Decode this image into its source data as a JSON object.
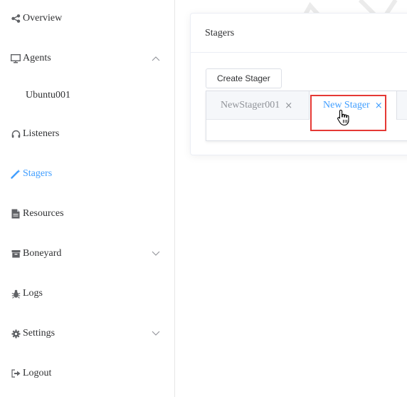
{
  "sidebar": {
    "items": [
      {
        "label": "Overview",
        "icon": "share-icon"
      },
      {
        "label": "Agents",
        "icon": "monitor-icon",
        "expanded": true
      },
      {
        "label": "Ubuntu001"
      },
      {
        "label": "Listeners",
        "icon": "headset-icon"
      },
      {
        "label": "Stagers",
        "icon": "magic-wand-icon",
        "active": true
      },
      {
        "label": "Resources",
        "icon": "document-icon"
      },
      {
        "label": "Boneyard",
        "icon": "box-icon",
        "expanded": false
      },
      {
        "label": "Logs",
        "icon": "bug-icon"
      },
      {
        "label": "Settings",
        "icon": "gear-icon",
        "expanded": false
      },
      {
        "label": "Logout",
        "icon": "logout-icon"
      }
    ]
  },
  "card": {
    "title": "Stagers",
    "create_button": "Create Stager",
    "tabs": [
      {
        "label": "NewStager001",
        "close": "×"
      },
      {
        "label": "New Stager",
        "close": "×",
        "active": true
      }
    ]
  },
  "colors": {
    "accent": "#409eff",
    "highlight": "#e53935",
    "text": "#303133",
    "muted": "#909399"
  }
}
